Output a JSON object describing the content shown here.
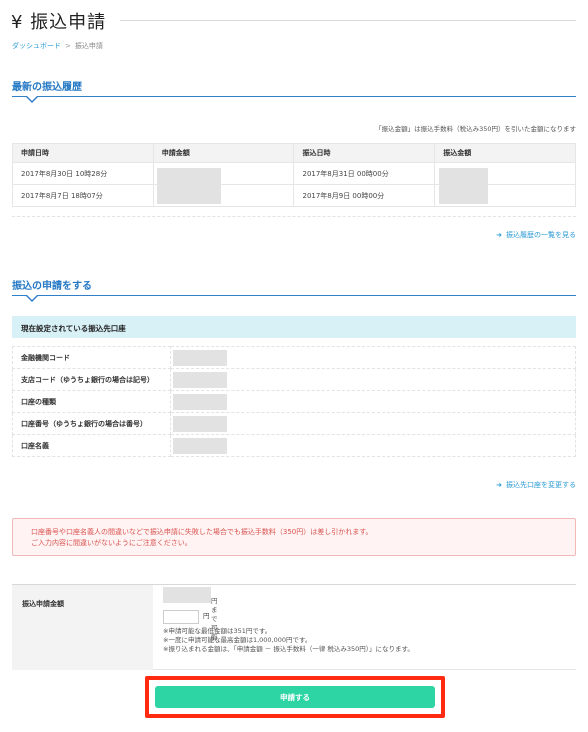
{
  "page": {
    "title": "¥ 振込申請"
  },
  "breadcrumb": {
    "home": "ダッシュボード",
    "separator": ">",
    "current": "振込申請"
  },
  "history": {
    "title": "最新の振込履歴",
    "note": "「振込金額」は振込手数料（税込み350円）を引いた金額になります",
    "headers": [
      "申請日時",
      "申請金額",
      "振込日時",
      "振込金額"
    ],
    "rows": [
      {
        "applied_at": "2017年8月30日 10時28分",
        "transfer_at": "2017年8月31日 00時00分"
      },
      {
        "applied_at": "2017年8月7日 18時07分",
        "transfer_at": "2017年8月9日 00時00分"
      }
    ],
    "more_link": "振込履歴の一覧を見る"
  },
  "apply": {
    "title": "振込の申請をする",
    "account_header": "現在設定されている振込先口座",
    "account_fields": [
      "金融機関コード",
      "支店コード（ゆうちょ銀行の場合は記号）",
      "口座の種類",
      "口座番号（ゆうちょ銀行の場合は番号）",
      "口座名義"
    ],
    "change_link": "振込先口座を変更する",
    "alert_line1": "口座番号や口座名義人の間違いなどで振込申請に失敗した場合でも振込手数料（350円）は差し引かれます。",
    "alert_line2": "ご入力内容に間違いがないようにご注意ください。",
    "amount_label": "振込申請金額",
    "available_suffix": "円まで可能",
    "yen_unit": "円",
    "hint1": "※申請可能な最低金額は351円です。",
    "hint2": "※一度に申請可能な最高金額は1,000,000円です。",
    "hint3": "※振り込まれる金額は、「申請金額 － 振込手数料（一律 税込み350円）」になります。",
    "submit_label": "申請する"
  }
}
